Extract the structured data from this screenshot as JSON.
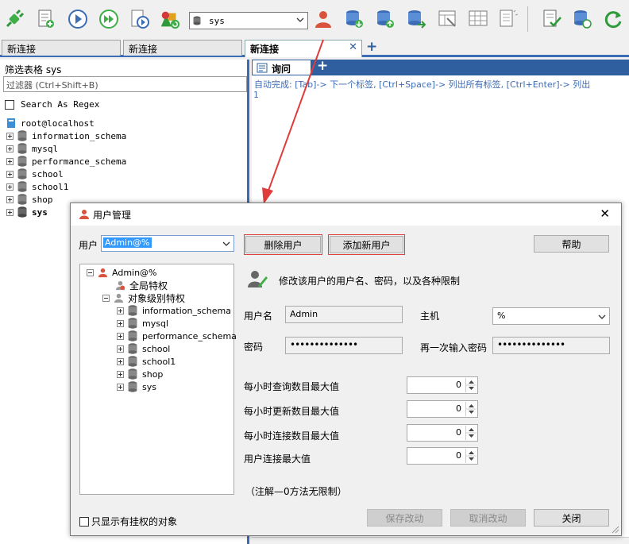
{
  "toolbar": {
    "db_select_value": "sys",
    "colors": {
      "accent_blue": "#3c6cb5",
      "green": "#2f9a3a",
      "red_arrow": "#e03c3c"
    }
  },
  "tabs": [
    {
      "label": "新连接"
    },
    {
      "label": "新连接"
    },
    {
      "label": "新连接"
    }
  ],
  "left_panel": {
    "filter_title": "筛选表格 sys",
    "filter_placeholder": "过滤器 (Ctrl+Shift+B)",
    "regex_label": "Search As Regex",
    "root_label": "root@localhost",
    "databases": [
      "information_schema",
      "mysql",
      "performance_schema",
      "school",
      "school1",
      "shop",
      "sys"
    ]
  },
  "editor": {
    "query_tab_label": "询问",
    "autocomplete_hint": "自动完成: [Tab]-> 下一个标签, [Ctrl+Space]-> 列出所有标签, [Ctrl+Enter]-> 列出",
    "line_number": "1"
  },
  "dialog": {
    "title": "用户管理",
    "user_label": "用户",
    "user_value": "Admin@%",
    "delete_user_btn": "删除用户",
    "add_user_btn": "添加新用户",
    "help_btn": "帮助",
    "tree_root": "Admin@%",
    "tree_global": "全局特权",
    "tree_object": "对象级别特权",
    "tree_dbs": [
      "information_schema",
      "mysql",
      "performance_schema",
      "school",
      "school1",
      "shop",
      "sys"
    ],
    "info_text": "修改该用户的用户名、密码，以及各种限制",
    "username_label": "用户名",
    "username_value": "Admin",
    "host_label": "主机",
    "host_value": "%",
    "password_label": "密码",
    "password_value": "••••••••••••••",
    "password_again_label": "再一次输入密码",
    "password_again_value": "••••••••••••••",
    "limits": [
      {
        "label": "每小时查询数目最大值",
        "value": "0"
      },
      {
        "label": "每小时更新数目最大值",
        "value": "0"
      },
      {
        "label": "每小时连接数目最大值",
        "value": "0"
      },
      {
        "label": "用户连接最大值",
        "value": "0"
      }
    ],
    "note": "（注解—0方法无限制）",
    "show_privileged_label": "只显示有挂权的对象",
    "save_btn": "保存改动",
    "cancel_btn": "取消改动",
    "close_btn": "关闭"
  }
}
